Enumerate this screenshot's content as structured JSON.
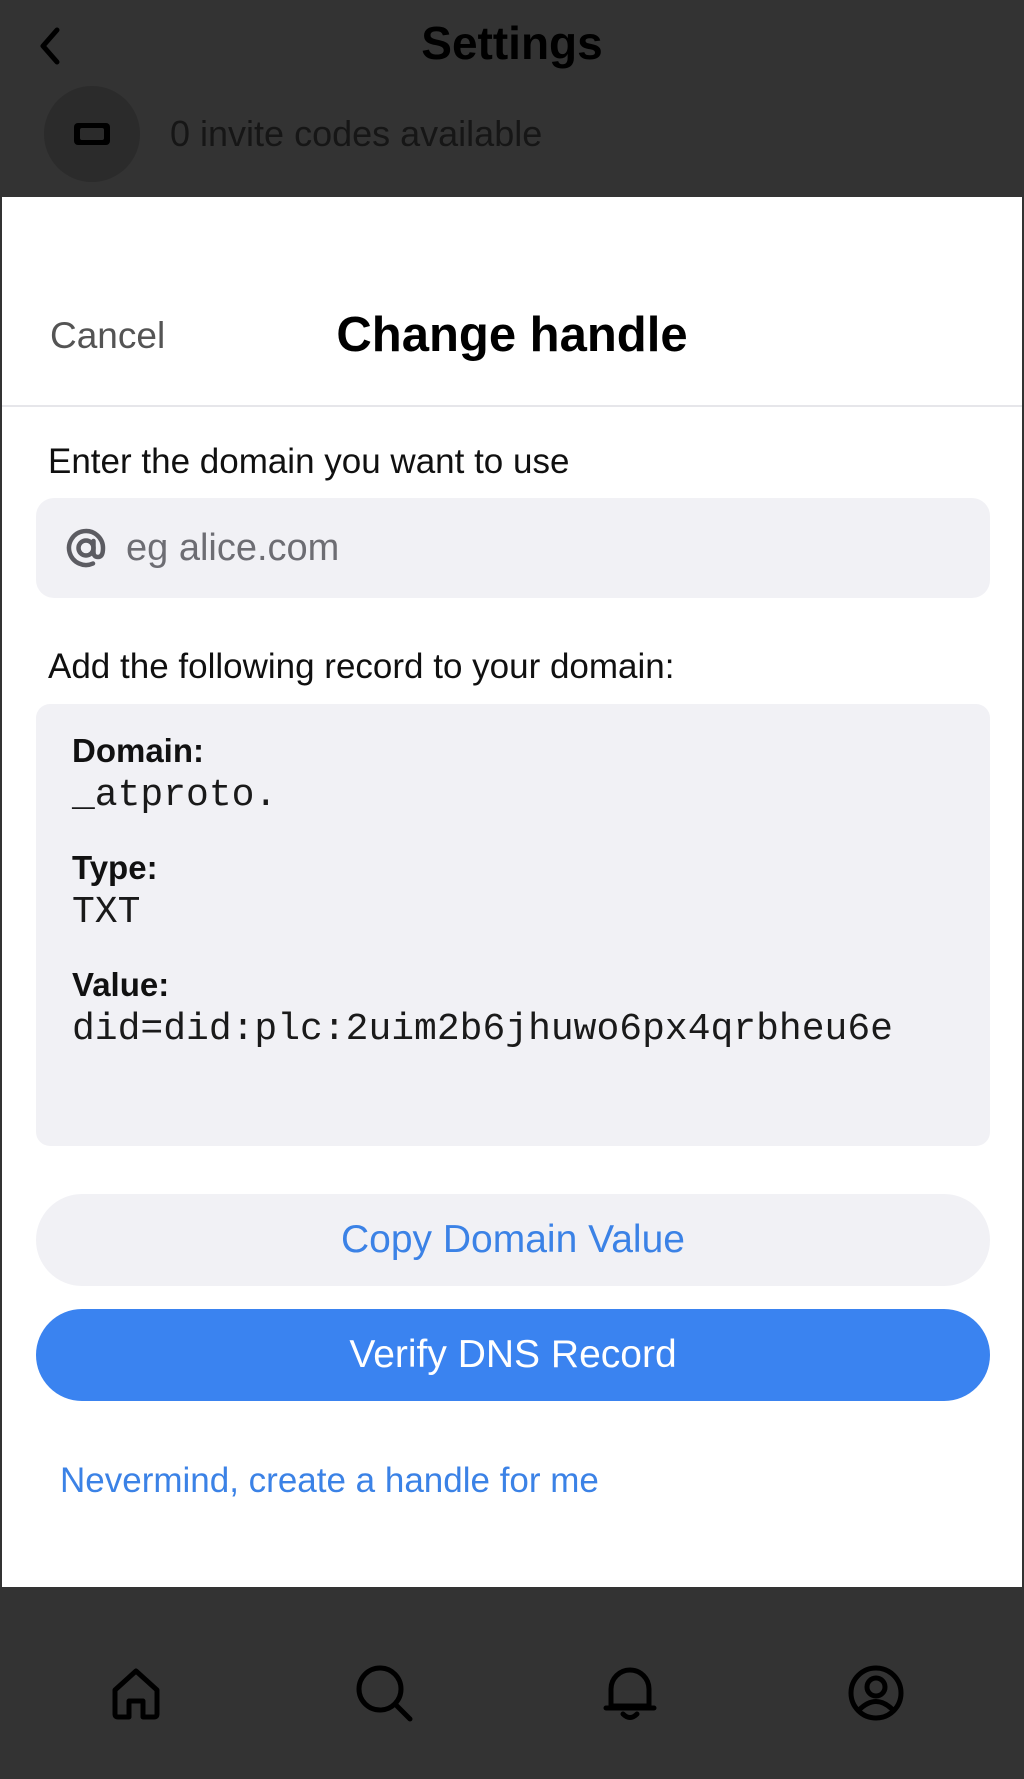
{
  "background": {
    "title": "Settings",
    "invite_text": "0 invite codes available",
    "icons": {
      "back": "chevron-left-icon",
      "invite": "ticket-icon"
    }
  },
  "modal": {
    "cancel_label": "Cancel",
    "title": "Change handle",
    "domain_prompt": "Enter the domain you want to use",
    "domain_input": {
      "value": "",
      "placeholder": "eg alice.com",
      "icon": "at-icon"
    },
    "record_prompt": "Add the following record to your domain:",
    "record": {
      "domain_label": "Domain:",
      "domain_value": "_atproto.",
      "type_label": "Type:",
      "type_value": "TXT",
      "value_label": "Value:",
      "value_value": "did=did:plc:2uim2b6jhuwo6px4qrbheu6e"
    },
    "copy_button": "Copy Domain Value",
    "verify_button": "Verify DNS Record",
    "nevermind_link": "Nevermind, create a handle for me"
  },
  "tabbar": {
    "items": [
      {
        "name": "home",
        "icon": "home-icon"
      },
      {
        "name": "search",
        "icon": "search-icon"
      },
      {
        "name": "notifications",
        "icon": "bell-icon"
      },
      {
        "name": "profile",
        "icon": "profile-icon"
      }
    ]
  },
  "colors": {
    "accent": "#3a83f0",
    "link": "#3b82e6",
    "field_bg": "#f1f1f5",
    "overlay": "#333333"
  }
}
